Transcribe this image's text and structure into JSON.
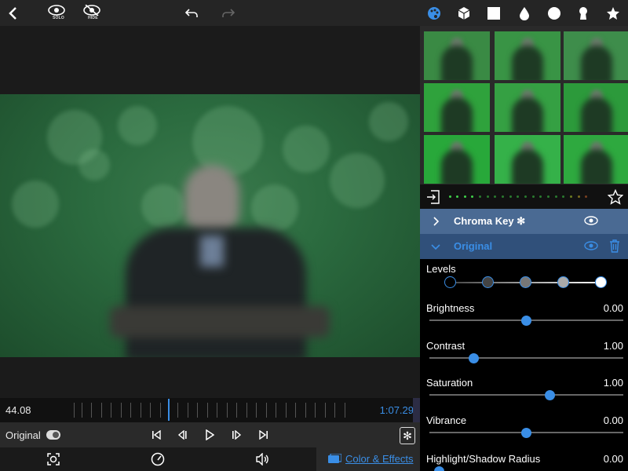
{
  "toolbar": {
    "solo_label": "SOLO",
    "hide_label": "HIDE"
  },
  "timeline": {
    "current_time": "44.08",
    "total_time": "1:07.29"
  },
  "transport": {
    "original_label": "Original"
  },
  "bottombar": {
    "color_effects_label": "Color & Effects"
  },
  "layers": [
    {
      "name": "Chroma Key ✻",
      "expanded": false
    },
    {
      "name": "Original",
      "expanded": true
    }
  ],
  "adjustments": {
    "levels_label": "Levels",
    "params": [
      {
        "label": "Brightness",
        "value": "0.00",
        "fraction": 0.5
      },
      {
        "label": "Contrast",
        "value": "1.00",
        "fraction": 0.23
      },
      {
        "label": "Saturation",
        "value": "1.00",
        "fraction": 0.62
      },
      {
        "label": "Vibrance",
        "value": "0.00",
        "fraction": 0.5
      },
      {
        "label": "Highlight/Shadow Radius",
        "value": "0.00",
        "fraction": 0.05
      }
    ]
  },
  "colors": {
    "accent": "#3a8ee6",
    "layer_chroma_bg": "#4a6a93",
    "layer_original_bg": "#30507a",
    "green_screen": "#2f8a3c"
  },
  "icons": {
    "top_left": [
      "back-icon",
      "solo-eye-icon",
      "hide-eye-icon",
      "undo-icon",
      "redo-icon"
    ],
    "top_right": [
      "palette-icon",
      "cube-icon",
      "square-icon",
      "drop-icon",
      "circle-icon",
      "keyhole-icon",
      "star-icon"
    ],
    "bottom": [
      "focus-icon",
      "speed-icon",
      "volume-icon",
      "color-effects-icon"
    ]
  }
}
